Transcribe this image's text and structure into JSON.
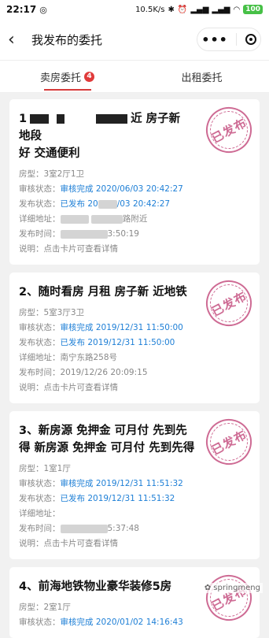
{
  "status": {
    "time": "22:17",
    "speed": "10.5K/s",
    "battery": "100"
  },
  "nav": {
    "back": "‹",
    "title": "我发布的委托",
    "more": "•••"
  },
  "tabs": [
    {
      "label": "卖房委托",
      "badge": "4",
      "active": true
    },
    {
      "label": "出租委托",
      "active": false
    }
  ],
  "stamp_text": "已发布",
  "labels": {
    "type": "房型：",
    "review": "审核状态：",
    "publish": "发布状态：",
    "addr": "详细地址：",
    "time": "发布时间：",
    "note": "说明："
  },
  "cards": [
    {
      "title_a": "1",
      "title_b": "近 房子新 地段",
      "title_c": "好 交通便利",
      "type": "3室2厅1卫",
      "review": "审核完成 2020/06/03 20:42:27",
      "publish_a": "已发布 20",
      "publish_b": "/03 20:42:27",
      "addr_a": "详细地址：",
      "addr_b": "路附近",
      "time_a": "发布时间：",
      "time_b": "3:50:19",
      "note": "点击卡片可查看详情"
    },
    {
      "title": "2、随时看房 月租 房子新 近地铁",
      "type": "5室3厅3卫",
      "review": "审核完成 2019/12/31 11:50:00",
      "publish": "已发布 2019/12/31 11:50:00",
      "addr": "南宁东路258号",
      "time": "2019/12/26 20:09:15",
      "note": "点击卡片可查看详情"
    },
    {
      "title": "3、新房源 免押金 可月付 先到先得 新房源 免押金 可月付 先到先得",
      "type": "1室1厅",
      "review": "审核完成 2019/12/31 11:51:32",
      "publish": "已发布 2019/12/31 11:51:32",
      "addr": "",
      "time_a": "发布时间：",
      "time_b": "5:37:48",
      "note": "点击卡片可查看详情"
    },
    {
      "title": "4、前海地铁物业豪华装修5房",
      "type": "2室1厅",
      "review": "审核完成 2020/01/02 14:16:43"
    }
  ],
  "watermark": "springmeng"
}
